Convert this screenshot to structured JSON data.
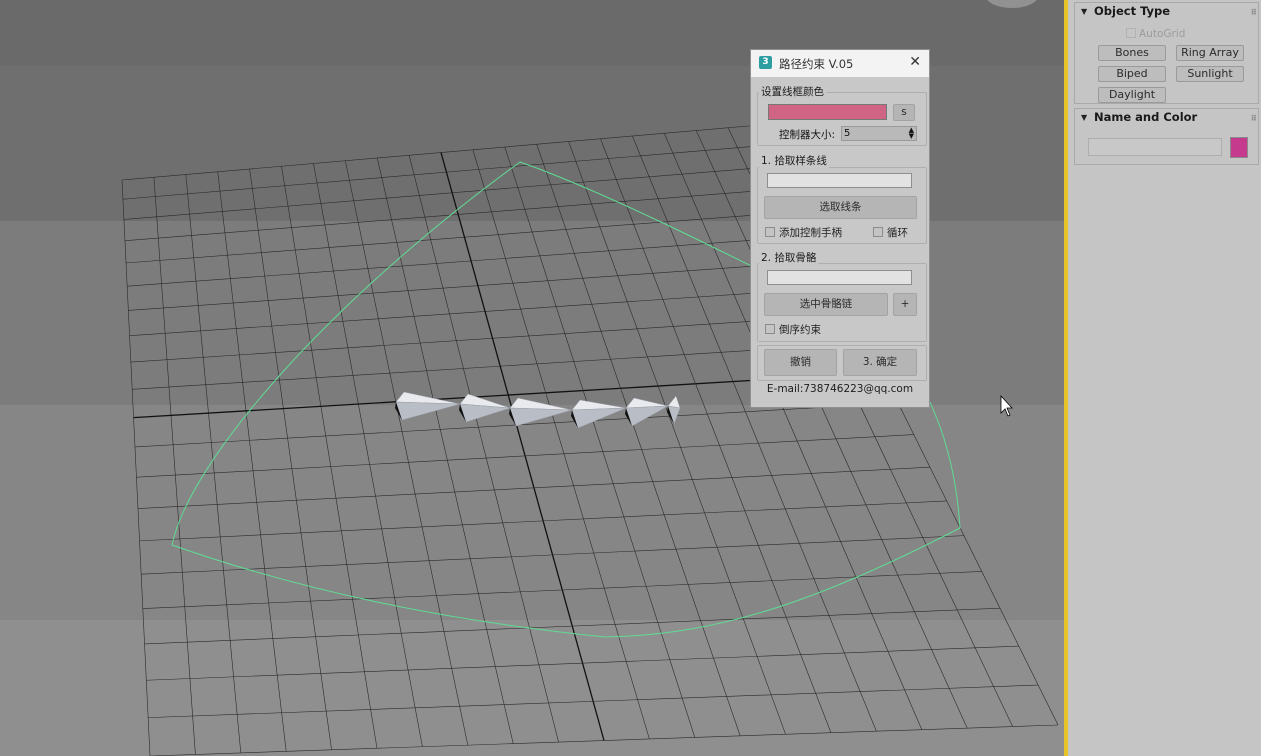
{
  "dialog": {
    "title": "路径约束 V.05",
    "logo_char": "3",
    "close_glyph": "✕",
    "color_group_label": "设置线框颜色",
    "color_value": "#d06484",
    "color_s_button": "s",
    "controller_size_label": "控制器大小:",
    "controller_size_value": "5",
    "spline_group_label": "1. 拾取样条线",
    "spline_field_value": "",
    "pick_spline_button": "选取线条",
    "add_handles_label": "添加控制手柄",
    "loop_label": "循环",
    "bones_group_label": "2. 拾取骨骼",
    "bones_field_value": "",
    "select_bone_chain_button": "选中骨骼链",
    "plus_button": "+",
    "reverse_label": "倒序约束",
    "undo_button": "撤销",
    "ok_button": "3. 确定",
    "email": "E-mail:738746223@qq.com"
  },
  "command_panel": {
    "object_type": {
      "title": "Object Type",
      "autogrid": "AutoGrid",
      "buttons": [
        "Bones",
        "Ring Array",
        "Biped",
        "Sunlight",
        "Daylight"
      ]
    },
    "name_and_color": {
      "title": "Name and Color",
      "name_value": "",
      "color": "#c63a8d"
    }
  },
  "viewport": {
    "spline_color": "#5fdc94",
    "grid_color": "#2a2a2a"
  }
}
